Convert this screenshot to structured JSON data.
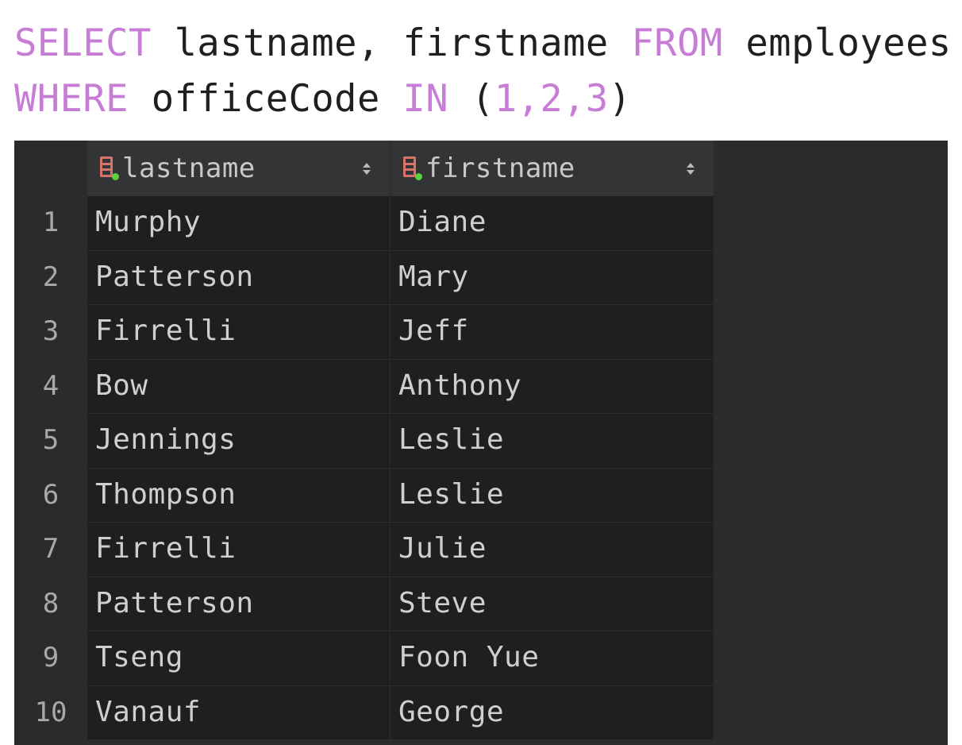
{
  "editor": {
    "line1": {
      "kw_select": "SELECT",
      "columns": " lastname, firstname ",
      "kw_from": "FROM",
      "table": " employees"
    },
    "line2": {
      "kw_where": "WHERE",
      "column": " officeCode ",
      "kw_in": "IN",
      "space": " ",
      "open_paren": "(",
      "values": "1,2,3",
      "close_paren": ")"
    },
    "colors": {
      "keyword": "#c77dd6",
      "text": "#1f1f1f"
    }
  },
  "result": {
    "columns": [
      {
        "label": "lastname",
        "icon": "table-column-icon"
      },
      {
        "label": "firstname",
        "icon": "table-column-icon"
      }
    ],
    "rows": [
      {
        "n": "1",
        "lastname": "Murphy",
        "firstname": "Diane"
      },
      {
        "n": "2",
        "lastname": "Patterson",
        "firstname": "Mary"
      },
      {
        "n": "3",
        "lastname": "Firrelli",
        "firstname": "Jeff"
      },
      {
        "n": "4",
        "lastname": "Bow",
        "firstname": "Anthony"
      },
      {
        "n": "5",
        "lastname": "Jennings",
        "firstname": "Leslie"
      },
      {
        "n": "6",
        "lastname": "Thompson",
        "firstname": "Leslie"
      },
      {
        "n": "7",
        "lastname": "Firrelli",
        "firstname": "Julie"
      },
      {
        "n": "8",
        "lastname": "Patterson",
        "firstname": "Steve"
      },
      {
        "n": "9",
        "lastname": "Tseng",
        "firstname": "Foon Yue"
      },
      {
        "n": "10",
        "lastname": "Vanauf",
        "firstname": "George"
      }
    ],
    "colors": {
      "background": "#2b2b2b",
      "cell": "#1e1f20",
      "header": "#323435",
      "icon": "#d9726b",
      "icon_dot": "#5bd13a"
    }
  }
}
